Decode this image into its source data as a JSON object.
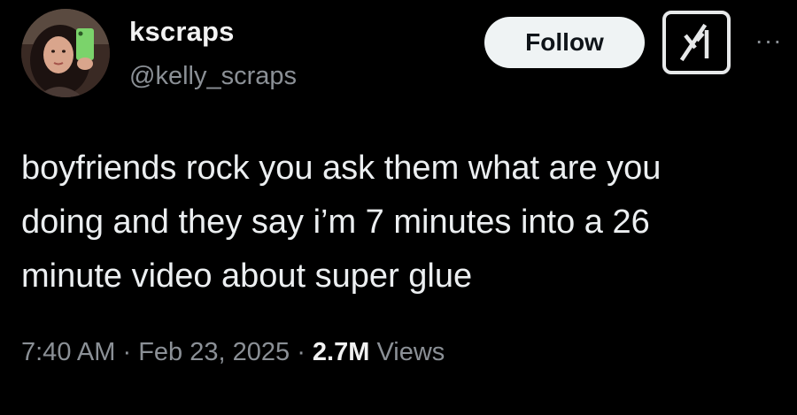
{
  "author": {
    "display_name": "kscraps",
    "handle": "@kelly_scraps"
  },
  "actions": {
    "follow_label": "Follow",
    "grok_icon": "grok-icon",
    "more_icon": "more-icon",
    "more_label": "···"
  },
  "tweet": {
    "text": "boyfriends rock you ask them what are you\ndoing and they say i’m 7 minutes into a 26\nminute video about super glue"
  },
  "meta": {
    "time": "7:40 AM",
    "separator": "·",
    "date": "Feb 23, 2025",
    "views_count": "2.7M",
    "views_label": "Views"
  },
  "colors": {
    "background": "#000000",
    "text_primary": "#e7e9ea",
    "text_secondary": "#8b9096",
    "follow_bg": "#eff3f4"
  }
}
